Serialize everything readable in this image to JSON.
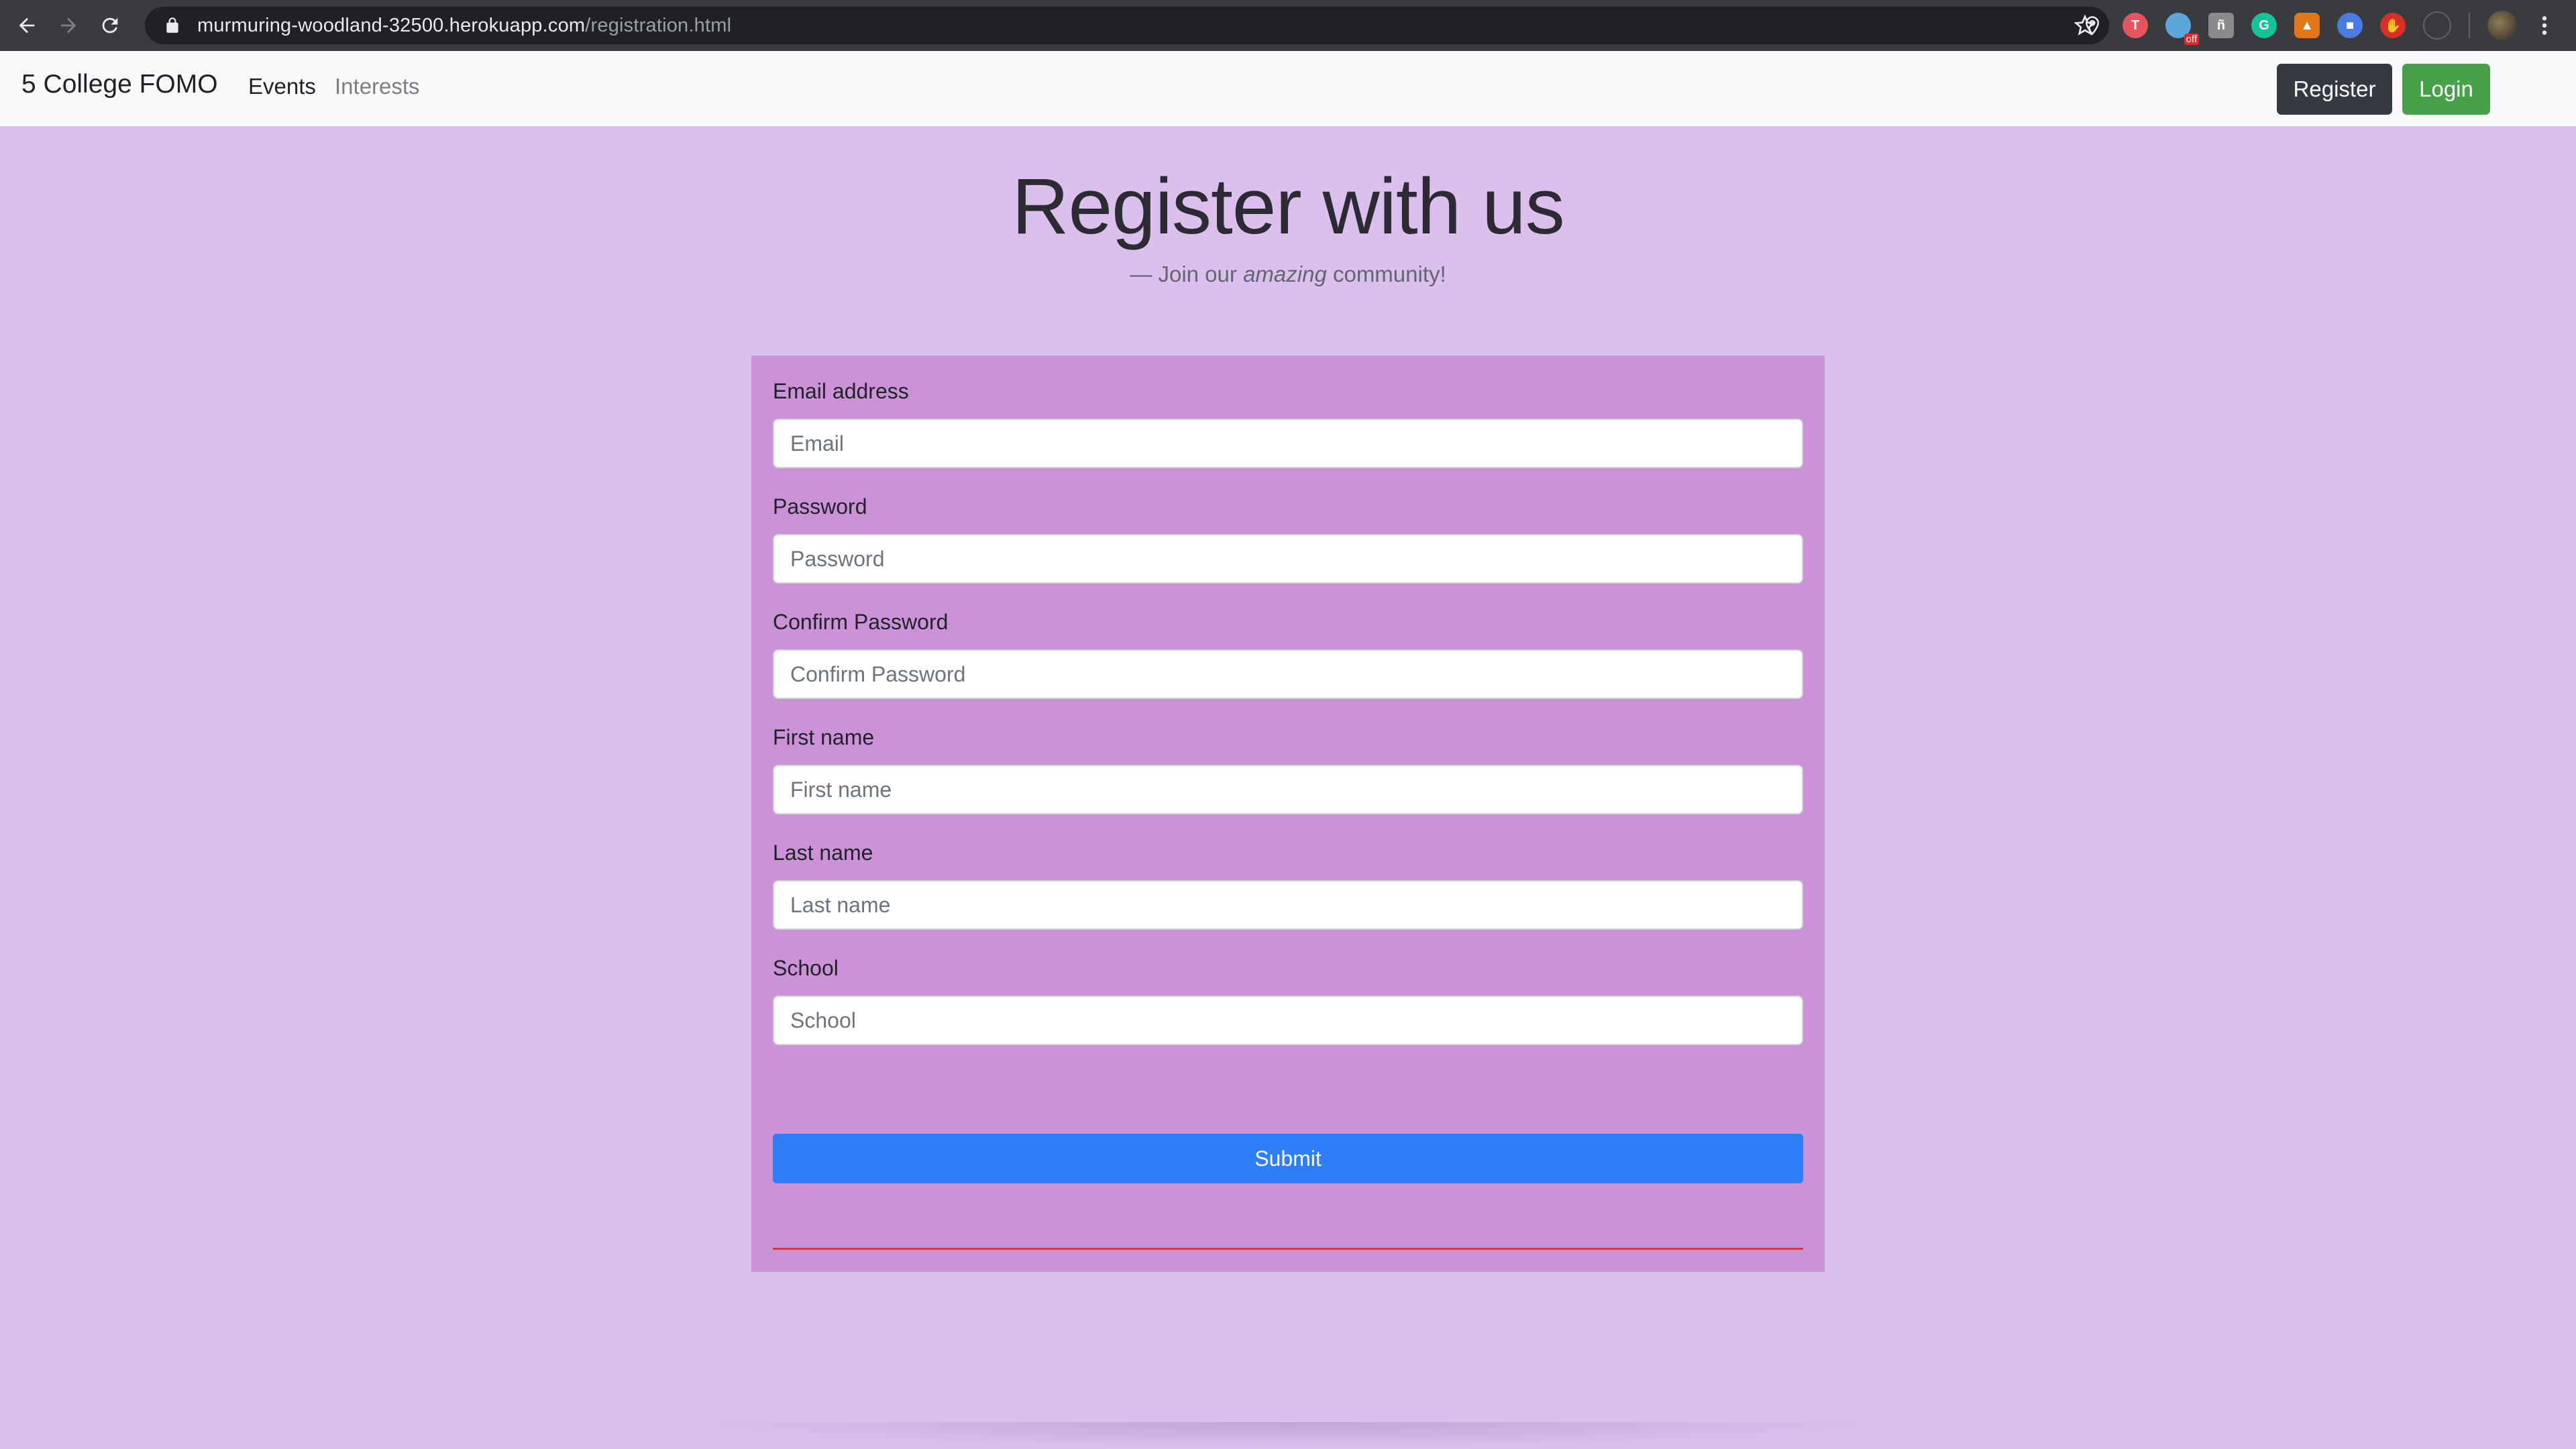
{
  "browser": {
    "url_host": "murmuring-woodland-32500.herokuapp.com",
    "url_path": "/registration.html",
    "extension_badge": "off",
    "colors": {
      "chrome_bg": "#3a3b3e",
      "omnibox_bg": "#202124"
    }
  },
  "navbar": {
    "brand": "5 College FOMO",
    "links": [
      {
        "label": "Events",
        "active": true
      },
      {
        "label": "Interests",
        "active": false
      }
    ],
    "register_label": "Register",
    "login_label": "Login",
    "colors": {
      "register_bg": "#343a40",
      "login_bg": "#46a149"
    }
  },
  "page": {
    "title": "Register with us",
    "subtitle_prefix": "— Join our ",
    "subtitle_em": "amazing",
    "subtitle_suffix": " community!",
    "background": "#dbc0ee"
  },
  "form": {
    "background": "#cc92d8",
    "fields": [
      {
        "label": "Email address",
        "placeholder": "Email",
        "value": ""
      },
      {
        "label": "Password",
        "placeholder": "Password",
        "value": ""
      },
      {
        "label": "Confirm Password",
        "placeholder": "Confirm Password",
        "value": ""
      },
      {
        "label": "First name",
        "placeholder": "First name",
        "value": ""
      },
      {
        "label": "Last name",
        "placeholder": "Last name",
        "value": ""
      },
      {
        "label": "School",
        "placeholder": "School",
        "value": ""
      }
    ],
    "submit_label": "Submit",
    "submit_color": "#2d7ef7",
    "rule_color": "#d9383f"
  }
}
